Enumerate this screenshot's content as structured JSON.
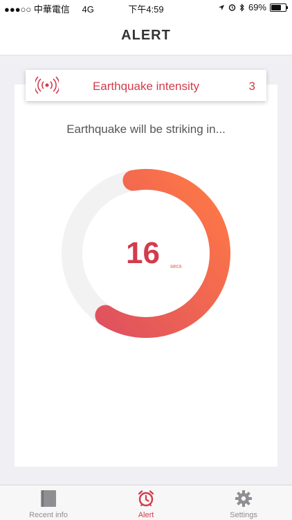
{
  "status_bar": {
    "carrier": "●●●○○ 中華電信",
    "network": "4G",
    "time": "下午4:59",
    "battery": "69%",
    "battery_level": 0.69
  },
  "nav": {
    "title": "ALERT"
  },
  "intensity": {
    "label": "Earthquake intensity",
    "value": "3"
  },
  "prompt": "Earthquake will be striking in...",
  "countdown": {
    "value": "16",
    "unit": "secs",
    "progress": 0.62
  },
  "tabs": [
    {
      "label": "Recent info",
      "icon": "book-icon",
      "active": false
    },
    {
      "label": "Alert",
      "icon": "alarm-clock-icon",
      "active": true
    },
    {
      "label": "Settings",
      "icon": "gear-icon",
      "active": false
    }
  ],
  "colors": {
    "accent": "#d23c4c",
    "ring_start": "#ff7a45",
    "ring_end": "#e0525e",
    "ring_track": "#f2f2f2",
    "background": "#efeff4"
  }
}
